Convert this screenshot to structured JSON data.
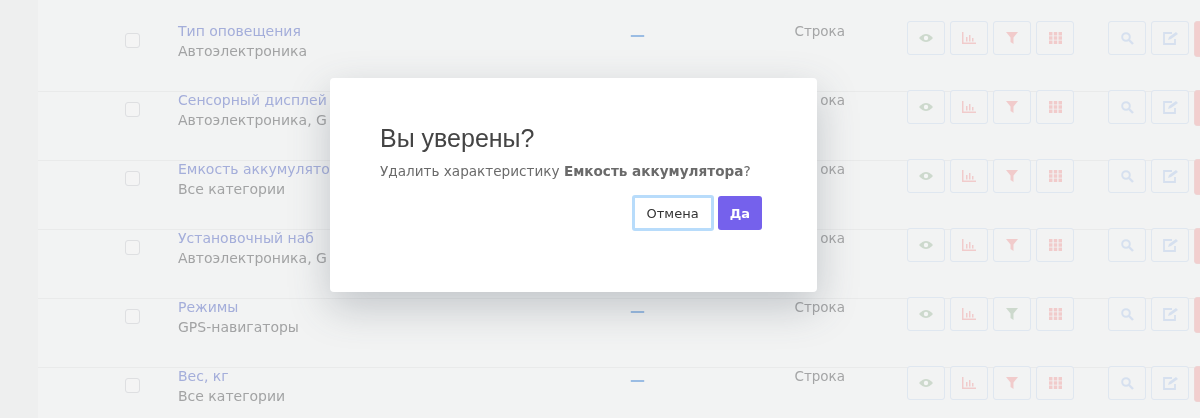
{
  "table": {
    "rows": [
      {
        "name": "Тип оповещения",
        "category": "Автоэлектроника",
        "value": "—",
        "type": "Строка",
        "checked": false,
        "filter_on": false
      },
      {
        "name": "Сенсорный дисплей",
        "category": "Автоэлектроника, G",
        "type": "ока",
        "checked": false,
        "filter_on": false
      },
      {
        "name": "Емкость аккумулято",
        "category": "Все категории",
        "type": "ока",
        "checked": false,
        "filter_on": false
      },
      {
        "name": "Установочный наб",
        "category": "Автоэлектроника, G",
        "type": "ока",
        "checked": false,
        "filter_on": false
      },
      {
        "name": "Режимы",
        "category": "GPS-навигаторы",
        "value": "—",
        "type": "Строка",
        "checked": false,
        "filter_on": true
      },
      {
        "name": "Вес, кг",
        "category": "Все категории",
        "value": "—",
        "type": "Строка",
        "checked": false,
        "filter_on": false
      }
    ]
  },
  "dialog": {
    "title": "Вы уверены?",
    "message": "Удалить характеристику **Емкость аккумулятора**?",
    "buttons": [
      {
        "label": "Отмена",
        "kind": "cancel",
        "focused": true
      },
      {
        "label": "Да",
        "kind": "confirm",
        "focused": false
      }
    ]
  }
}
